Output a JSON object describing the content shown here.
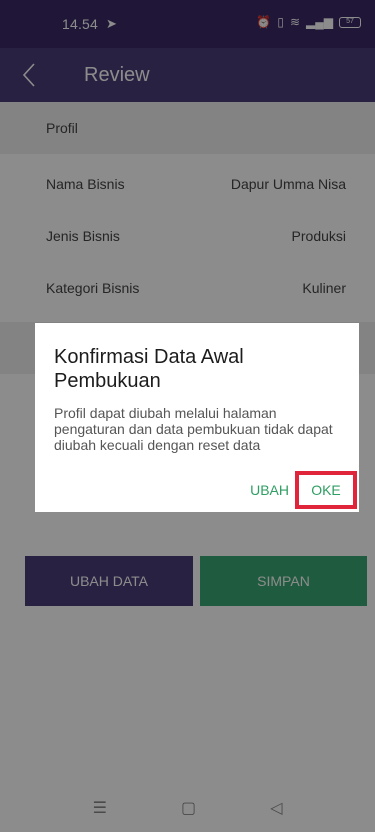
{
  "status_bar": {
    "time": "14.54",
    "battery": "57"
  },
  "header": {
    "title": "Review"
  },
  "profile": {
    "section_label": "Profil",
    "rows": [
      {
        "label": "Nama Bisnis",
        "value": "Dapur Umma Nisa"
      },
      {
        "label": "Jenis Bisnis",
        "value": "Produksi"
      },
      {
        "label": "Kategori Bisnis",
        "value": "Kuliner"
      }
    ]
  },
  "actions": {
    "edit_label": "UBAH DATA",
    "save_label": "SIMPAN"
  },
  "dialog": {
    "title": "Konfirmasi Data Awal Pembukuan",
    "message": "Profil dapat diubah melalui halaman pengaturan dan data pembukuan tidak dapat diubah kecuali dengan reset data",
    "cancel_label": "UBAH",
    "confirm_label": "OKE"
  },
  "colors": {
    "primary": "#4a3c78",
    "accent": "#3aa874",
    "highlight": "#e0243a"
  }
}
